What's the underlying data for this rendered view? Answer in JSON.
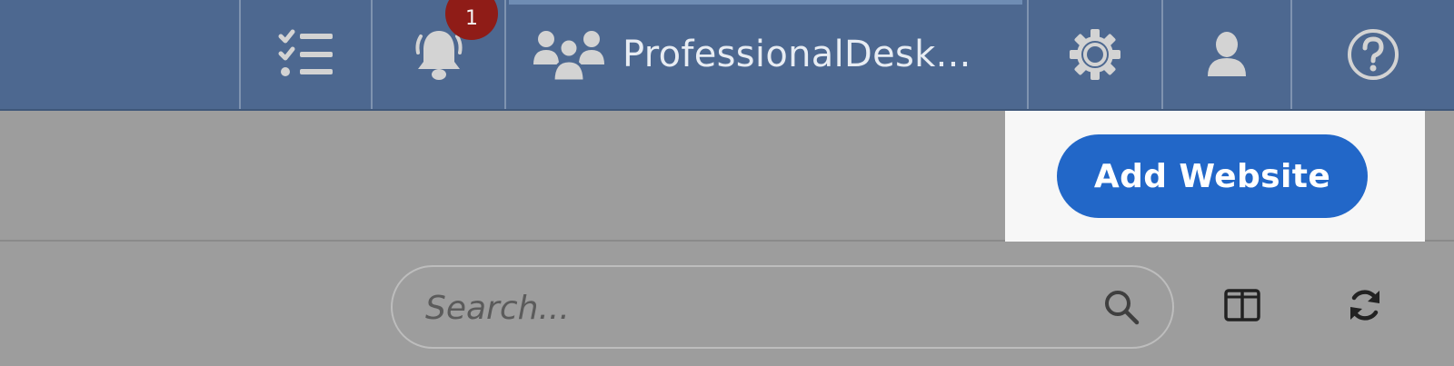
{
  "header": {
    "tasks_icon": "checklist-icon",
    "notifications": {
      "icon": "bell-icon",
      "count": "1"
    },
    "account": {
      "icon": "users-group-icon",
      "name": "ProfessionalDesk..."
    },
    "settings_icon": "gear-icon",
    "profile_icon": "user-icon",
    "help_icon": "help-circle-icon",
    "colors": {
      "bar": "#4d6890",
      "badge": "#8f1c17",
      "icon": "#d3d3d3"
    }
  },
  "actions": {
    "add_website_label": "Add Website",
    "button_color": "#2267c8"
  },
  "toolbar": {
    "search_placeholder": "Search...",
    "search_icon": "search-icon",
    "columns_icon": "columns-icon",
    "refresh_icon": "refresh-icon"
  }
}
